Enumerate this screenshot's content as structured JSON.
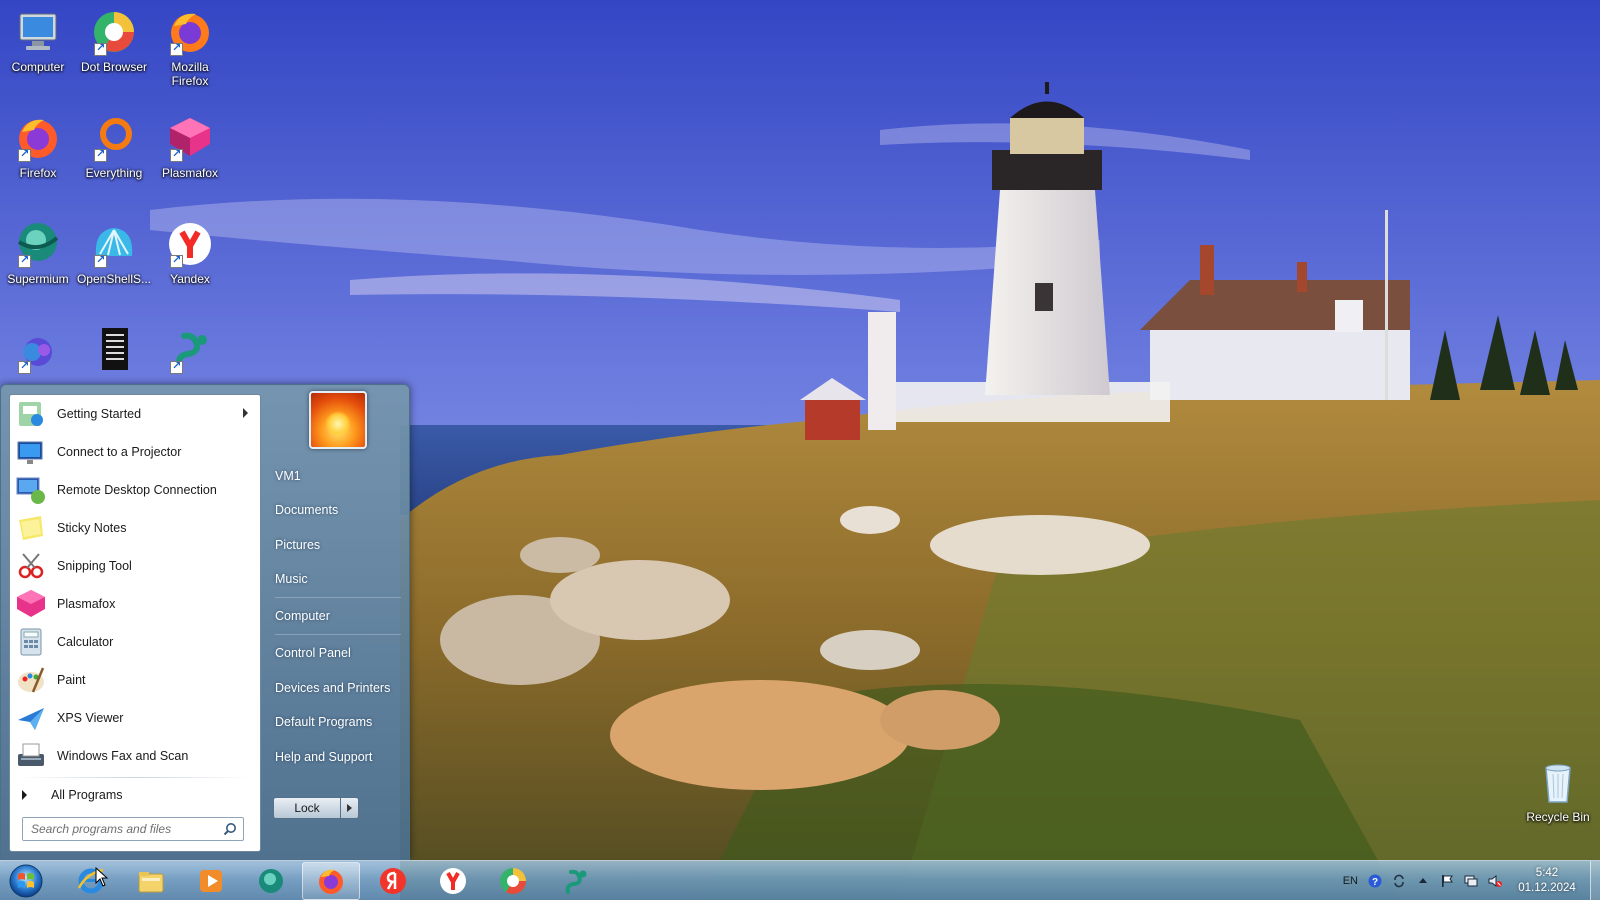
{
  "desktop": {
    "icons": [
      {
        "label": "Computer",
        "icon": "computer-icon"
      },
      {
        "label": "Dot Browser",
        "icon": "dot-browser-icon"
      },
      {
        "label": "Mozilla Firefox",
        "icon": "firefox-icon"
      },
      {
        "label": "Firefox",
        "icon": "firefox-icon"
      },
      {
        "label": "Everything",
        "icon": "everything-icon"
      },
      {
        "label": "Plasmafox",
        "icon": "plasmafox-icon"
      },
      {
        "label": "Supermium",
        "icon": "supermium-icon"
      },
      {
        "label": "OpenShellS...",
        "icon": "openshell-icon"
      },
      {
        "label": "Yandex",
        "icon": "yandex-icon"
      },
      {
        "label": "",
        "icon": "edge-icon"
      },
      {
        "label": "",
        "icon": "document-icon"
      },
      {
        "label": "",
        "icon": "serpent-icon"
      }
    ],
    "recycle_bin": {
      "label": "Recycle Bin",
      "icon": "recycle-bin-icon"
    }
  },
  "start_menu": {
    "programs": [
      {
        "label": "Getting Started",
        "icon": "getting-started-icon",
        "submenu": true
      },
      {
        "label": "Connect to a Projector",
        "icon": "projector-icon"
      },
      {
        "label": "Remote Desktop Connection",
        "icon": "remote-desktop-icon"
      },
      {
        "label": "Sticky Notes",
        "icon": "sticky-notes-icon"
      },
      {
        "label": "Snipping Tool",
        "icon": "snipping-tool-icon"
      },
      {
        "label": "Plasmafox",
        "icon": "plasmafox-icon"
      },
      {
        "label": "Calculator",
        "icon": "calculator-icon"
      },
      {
        "label": "Paint",
        "icon": "paint-icon"
      },
      {
        "label": "XPS Viewer",
        "icon": "xps-viewer-icon"
      },
      {
        "label": "Windows Fax and Scan",
        "icon": "fax-scan-icon"
      }
    ],
    "all_programs_label": "All Programs",
    "search_placeholder": "Search programs and files",
    "right_links": {
      "user": "VM1",
      "documents": "Documents",
      "pictures": "Pictures",
      "music": "Music",
      "computer": "Computer",
      "control_panel": "Control Panel",
      "devices": "Devices and Printers",
      "default_programs": "Default Programs",
      "help": "Help and Support"
    },
    "lock_label": "Lock"
  },
  "taskbar": {
    "pinned": [
      "internet-explorer-icon",
      "file-explorer-icon",
      "media-player-icon",
      "supermium-icon",
      "firefox-icon",
      "yandex-browser-icon",
      "yandex-icon",
      "dot-browser-icon",
      "serpent-icon"
    ],
    "active_index": 4,
    "language": "EN",
    "clock_time": "5:42",
    "clock_date": "01.12.2024"
  },
  "colors": {
    "taskbar": "#7ea6c6",
    "start_menu_panel": "#6b8ea8",
    "sky": "#4a5fd0"
  }
}
